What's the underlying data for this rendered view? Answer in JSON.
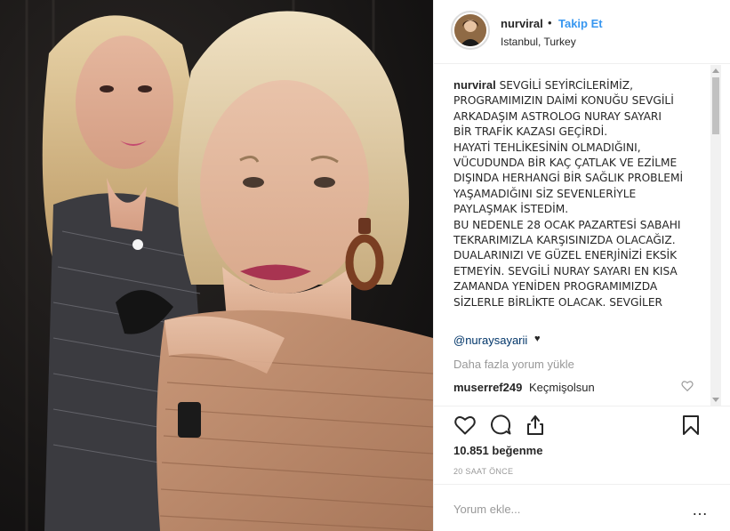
{
  "post": {
    "username": "nurviral",
    "separator": "•",
    "follow_label": "Takip Et",
    "location": "Istanbul, Turkey"
  },
  "caption": {
    "username": "nurviral",
    "lines": [
      "SEVGİLİ SEYİRCİLERİMİZ,",
      "PROGRAMIMIZIN DAİMİ KONUĞU SEVGİLİ",
      "ARKADAŞIM ASTROLOG NURAY SAYARI",
      "BİR TRAFİK KAZASI GEÇİRDİ.",
      "HAYATİ TEHLİKESİNİN OLMADIĞINI,",
      "VÜCUDUNDA BİR KAÇ ÇATLAK VE EZİLME",
      "DIŞINDA HERHANGİ BİR SAĞLIK PROBLEMİ",
      "YAŞAMADIĞINI SİZ SEVENLERİYLE",
      "PAYLAŞMAK İSTEDİM.",
      "BU NEDENLE 28 OCAK PAZARTESİ SABAHI",
      "TEKRARIMIZLA KARŞISINIZDA OLACAĞIZ.",
      "DUALARINIZI VE GÜZEL ENERJİNİZİ EKSİK",
      "ETMEYİN. SEVGİLİ NURAY SAYARI EN KISA",
      "ZAMANDA YENİDEN PROGRAMIMIZDA",
      "SİZLERLE BİRLİKTE OLACAK. SEVGİLER"
    ],
    "mention": "@nuraysayarii",
    "heart": "♥"
  },
  "load_more_label": "Daha fazla yorum yükle",
  "comment": {
    "username": "muserref249",
    "text": "Keçmişolsun"
  },
  "likes_text": "10.851 beğenme",
  "time_text": "20 SAAT ÖNCE",
  "add_comment_placeholder": "Yorum ekle...",
  "more_label": "…",
  "icons": {
    "like": "heart-icon",
    "comment": "comment-icon",
    "share": "share-icon",
    "save": "bookmark-icon",
    "comment_like": "heart-outline-icon"
  }
}
